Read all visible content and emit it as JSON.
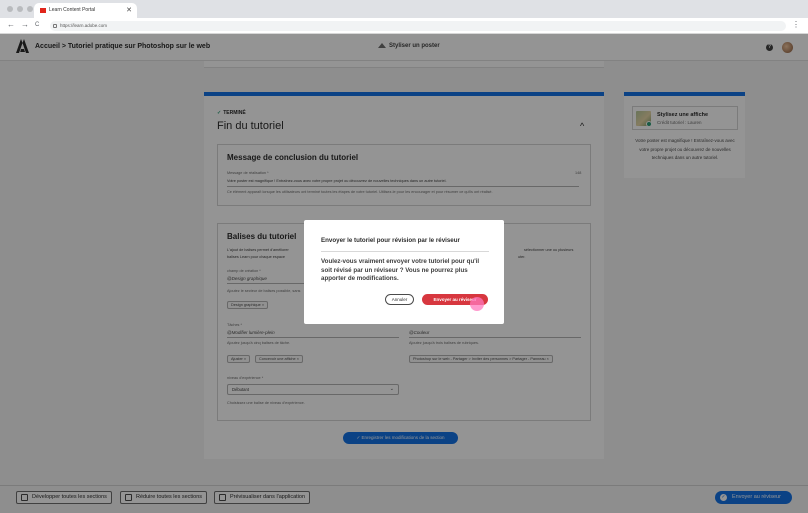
{
  "browser": {
    "tab_title": "Learn Content Portal",
    "tab_close": "✕",
    "url": "https://learn.adobe.com",
    "back": "←",
    "forward": "→",
    "reload": "C",
    "menu": "⋮"
  },
  "header": {
    "breadcrumb": "Accueil > Tutoriel pratique sur Photoshop sur le web",
    "center_title": "Styliser un poster",
    "help": "?"
  },
  "main": {
    "status": "TERMINÉ",
    "section_title": "Fin du tutoriel",
    "collapse": "^",
    "conclusion": {
      "title": "Message de conclusion du tutoriel",
      "field_label": "Message de réalisation *",
      "field_value": "Votre poster est magnifique ! Entraînez-vous avec votre propre projet ou découvrez de nouvelles techniques dans un autre tutoriel.",
      "counter": "148",
      "help": "Ce élément apparaît lorsque les utilisateurs ont terminé toutes les étapes de votre tutoriel. Utilisez-le pour les encourager et pour résumer ce qu'ils ont réalisé."
    },
    "tags": {
      "title": "Balises du tutoriel",
      "intro_left": "L'ajout de balises permet d'améliorer",
      "intro_left2": "balises Learn pour chaque espace",
      "intro_right": "sélectionner une ou plusieurs",
      "intro_right2": "uter.",
      "domain_label": "champ de création *",
      "domain_value": "@Design graphique",
      "domain_help": "Ajoutez le secteur de balises possible, sans",
      "domain_chip": "Design graphique",
      "tasks_label": "Tâches *",
      "tasks_value": "@Modifier lumière-plein",
      "tasks_help": "Ajoutez jusqu'à cinq balises de tâche.",
      "task_chips": [
        "Ajuster",
        "Concevoir une affiche"
      ],
      "topics_value": "@Couleur",
      "topics_help": "Ajoutez jusqu'à trois balises de rubriques.",
      "topic_chip": "Photoshop sur le web - Partager > Inviter des personnes > Partager - Panneau",
      "level_label": "niveau d'expérience *",
      "level_value": "Débutant",
      "level_help": "Choisissez une balise de niveau d'expérience.",
      "chip_close": "×"
    },
    "save_button": "Enregistrer les modifications de la section"
  },
  "right_panel": {
    "card_title": "Stylisez une affiche",
    "card_credit": "Crédit tutoriel : Lauren",
    "description": "Votre poster est magnifique ! Entraînez-vous avec votre propre projet ou découvrez de nouvelles techniques dans un autre tutoriel."
  },
  "modal": {
    "title": "Envoyer le tutoriel pour révision par le réviseur",
    "body": "Voulez-vous vraiment envoyer votre tutoriel pour qu'il soit révisé par un réviseur ? Vous ne pourrez plus apporter de modifications.",
    "cancel": "Annuler",
    "confirm": "Envoyer au réviseur"
  },
  "footer": {
    "expand_all": "Développer toutes les sections",
    "collapse_all": "Réduire toutes les sections",
    "preview": "Prévisualiser dans l'application",
    "send": "Envoyer au réviseur"
  },
  "colors": {
    "accent": "#1473e6",
    "danger": "#d7373f",
    "success": "#2d9d78"
  }
}
